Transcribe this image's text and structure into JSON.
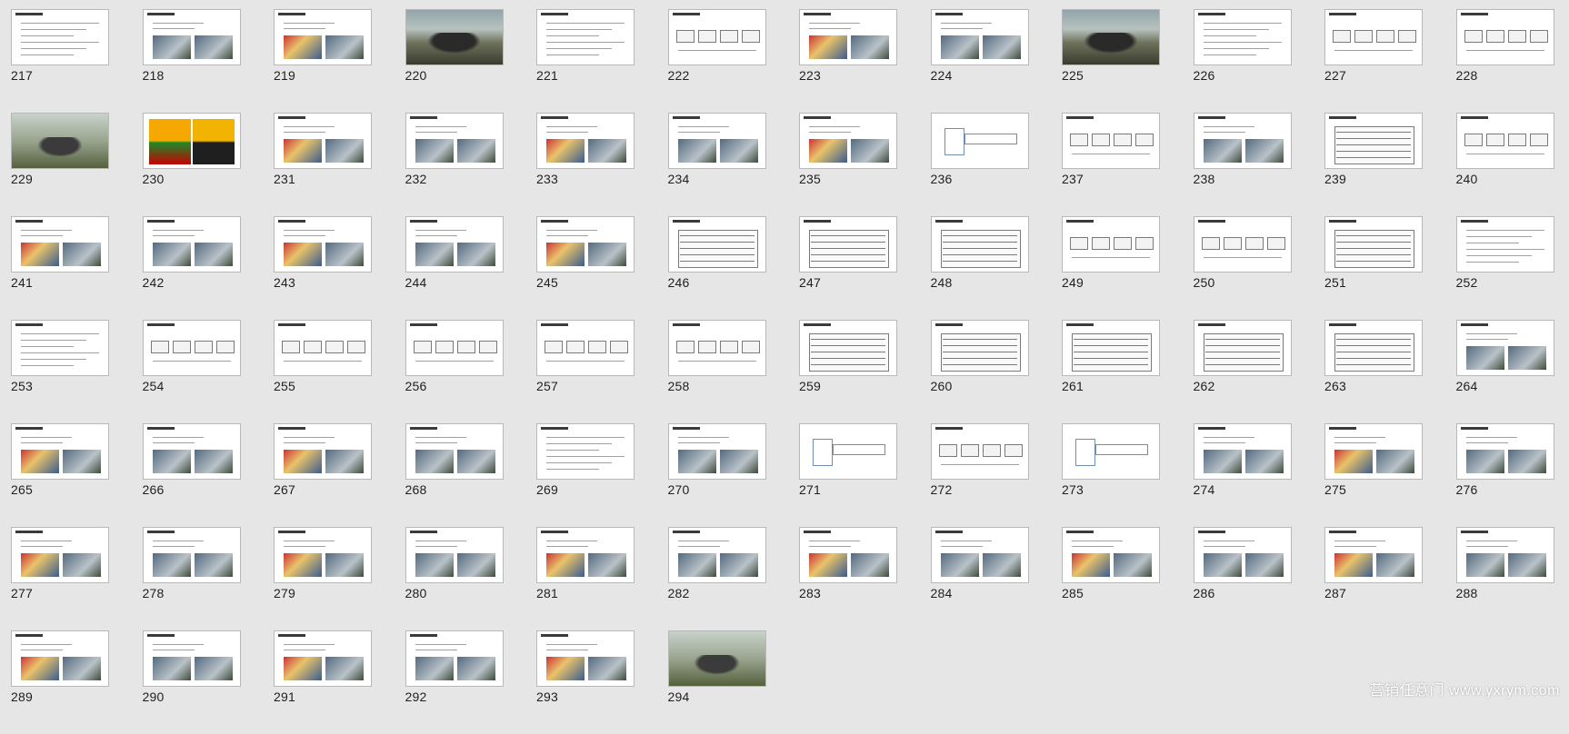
{
  "slides": [
    {
      "number": "217",
      "style": "text"
    },
    {
      "number": "218",
      "style": "mixed"
    },
    {
      "number": "219",
      "style": "mixed"
    },
    {
      "number": "220",
      "style": "photo"
    },
    {
      "number": "221",
      "style": "text"
    },
    {
      "number": "222",
      "style": "boxes"
    },
    {
      "number": "223",
      "style": "mixed"
    },
    {
      "number": "224",
      "style": "mixed"
    },
    {
      "number": "225",
      "style": "photo"
    },
    {
      "number": "226",
      "style": "text"
    },
    {
      "number": "227",
      "style": "boxes"
    },
    {
      "number": "228",
      "style": "boxes"
    },
    {
      "number": "229",
      "style": "photo2"
    },
    {
      "number": "230",
      "style": "brands"
    },
    {
      "number": "231",
      "style": "mixed"
    },
    {
      "number": "232",
      "style": "mixed"
    },
    {
      "number": "233",
      "style": "mixed"
    },
    {
      "number": "234",
      "style": "mixed"
    },
    {
      "number": "235",
      "style": "mixed"
    },
    {
      "number": "236",
      "style": "section"
    },
    {
      "number": "237",
      "style": "boxes"
    },
    {
      "number": "238",
      "style": "mixed"
    },
    {
      "number": "239",
      "style": "table"
    },
    {
      "number": "240",
      "style": "boxes"
    },
    {
      "number": "241",
      "style": "mixed"
    },
    {
      "number": "242",
      "style": "mixed"
    },
    {
      "number": "243",
      "style": "mixed"
    },
    {
      "number": "244",
      "style": "mixed"
    },
    {
      "number": "245",
      "style": "mixed"
    },
    {
      "number": "246",
      "style": "table"
    },
    {
      "number": "247",
      "style": "table"
    },
    {
      "number": "248",
      "style": "table"
    },
    {
      "number": "249",
      "style": "boxes"
    },
    {
      "number": "250",
      "style": "boxes"
    },
    {
      "number": "251",
      "style": "table"
    },
    {
      "number": "252",
      "style": "text"
    },
    {
      "number": "253",
      "style": "text"
    },
    {
      "number": "254",
      "style": "boxes"
    },
    {
      "number": "255",
      "style": "boxes"
    },
    {
      "number": "256",
      "style": "boxes"
    },
    {
      "number": "257",
      "style": "boxes"
    },
    {
      "number": "258",
      "style": "boxes"
    },
    {
      "number": "259",
      "style": "table"
    },
    {
      "number": "260",
      "style": "table"
    },
    {
      "number": "261",
      "style": "table"
    },
    {
      "number": "262",
      "style": "table"
    },
    {
      "number": "263",
      "style": "table"
    },
    {
      "number": "264",
      "style": "mixed"
    },
    {
      "number": "265",
      "style": "mixed"
    },
    {
      "number": "266",
      "style": "mixed"
    },
    {
      "number": "267",
      "style": "mixed"
    },
    {
      "number": "268",
      "style": "mixed"
    },
    {
      "number": "269",
      "style": "text"
    },
    {
      "number": "270",
      "style": "mixed"
    },
    {
      "number": "271",
      "style": "section"
    },
    {
      "number": "272",
      "style": "boxes"
    },
    {
      "number": "273",
      "style": "section"
    },
    {
      "number": "274",
      "style": "mixed"
    },
    {
      "number": "275",
      "style": "mixed"
    },
    {
      "number": "276",
      "style": "mixed"
    },
    {
      "number": "277",
      "style": "mixed"
    },
    {
      "number": "278",
      "style": "mixed"
    },
    {
      "number": "279",
      "style": "mixed"
    },
    {
      "number": "280",
      "style": "mixed"
    },
    {
      "number": "281",
      "style": "mixed"
    },
    {
      "number": "282",
      "style": "mixed"
    },
    {
      "number": "283",
      "style": "mixed"
    },
    {
      "number": "284",
      "style": "mixed"
    },
    {
      "number": "285",
      "style": "mixed"
    },
    {
      "number": "286",
      "style": "mixed"
    },
    {
      "number": "287",
      "style": "mixed"
    },
    {
      "number": "288",
      "style": "mixed"
    },
    {
      "number": "289",
      "style": "mixed"
    },
    {
      "number": "290",
      "style": "mixed"
    },
    {
      "number": "291",
      "style": "mixed"
    },
    {
      "number": "292",
      "style": "mixed"
    },
    {
      "number": "293",
      "style": "mixed"
    },
    {
      "number": "294",
      "style": "photo2"
    }
  ],
  "watermark": "营销任意门 www.yxrym.com"
}
